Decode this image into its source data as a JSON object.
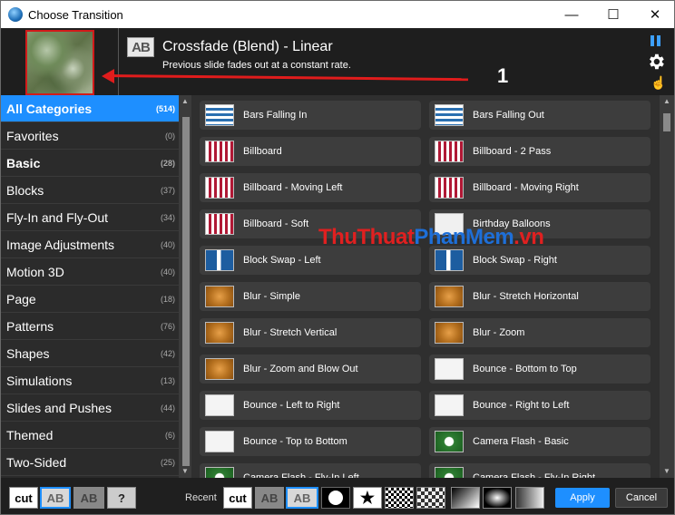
{
  "window": {
    "title": "Choose Transition",
    "minimize_glyph": "—",
    "maximize_glyph": "☐",
    "close_glyph": "✕"
  },
  "header": {
    "icon_text": "AB",
    "transition_name": "Crossfade (Blend) - Linear",
    "transition_desc": "Previous slide fades out at a constant rate.",
    "annotation_number": "1"
  },
  "categories": [
    {
      "label": "All Categories",
      "count": "(514)"
    },
    {
      "label": "Favorites",
      "count": "(0)"
    },
    {
      "label": "Basic",
      "count": "(28)"
    },
    {
      "label": "Blocks",
      "count": "(37)"
    },
    {
      "label": "Fly-In and Fly-Out",
      "count": "(34)"
    },
    {
      "label": "Image Adjustments",
      "count": "(40)"
    },
    {
      "label": "Motion 3D",
      "count": "(40)"
    },
    {
      "label": "Page",
      "count": "(18)"
    },
    {
      "label": "Patterns",
      "count": "(76)"
    },
    {
      "label": "Shapes",
      "count": "(42)"
    },
    {
      "label": "Simulations",
      "count": "(13)"
    },
    {
      "label": "Slides and Pushes",
      "count": "(44)"
    },
    {
      "label": "Themed",
      "count": "(6)"
    },
    {
      "label": "Two-Sided",
      "count": "(25)"
    }
  ],
  "transitions": [
    {
      "label": "Bars Falling In",
      "icon": "bars-icon"
    },
    {
      "label": "Bars Falling Out",
      "icon": "bars-icon"
    },
    {
      "label": "Billboard",
      "icon": "billboard-icon"
    },
    {
      "label": "Billboard - 2 Pass",
      "icon": "billboard-icon"
    },
    {
      "label": "Billboard - Moving Left",
      "icon": "billboard-icon"
    },
    {
      "label": "Billboard - Moving Right",
      "icon": "billboard-icon"
    },
    {
      "label": "Billboard - Soft",
      "icon": "billboard-icon"
    },
    {
      "label": "Birthday Balloons",
      "icon": "balloon-icon"
    },
    {
      "label": "Block Swap - Left",
      "icon": "blockswap-icon"
    },
    {
      "label": "Block Swap - Right",
      "icon": "blockswap-icon"
    },
    {
      "label": "Blur - Simple",
      "icon": "blur-icon"
    },
    {
      "label": "Blur - Stretch Horizontal",
      "icon": "blur-icon"
    },
    {
      "label": "Blur - Stretch Vertical",
      "icon": "blur-icon"
    },
    {
      "label": "Blur - Zoom",
      "icon": "blur-icon"
    },
    {
      "label": "Blur - Zoom and Blow Out",
      "icon": "blur-icon"
    },
    {
      "label": "Bounce - Bottom to Top",
      "icon": "bounce-icon"
    },
    {
      "label": "Bounce - Left to Right",
      "icon": "bounce-icon"
    },
    {
      "label": "Bounce - Right to Left",
      "icon": "bounce-icon"
    },
    {
      "label": "Bounce - Top to Bottom",
      "icon": "bounce-icon"
    },
    {
      "label": "Camera Flash - Basic",
      "icon": "camera-icon"
    },
    {
      "label": "Camera Flash - Fly-In Left",
      "icon": "camera-icon"
    },
    {
      "label": "Camera Flash - Fly-In Right",
      "icon": "camera-icon"
    }
  ],
  "bottom": {
    "cut": "cut",
    "ab": "AB",
    "question": "?",
    "recent_label": "Recent",
    "star": "★",
    "apply": "Apply",
    "cancel": "Cancel"
  },
  "watermark": {
    "part1": "Thu",
    "part2": "Thuat",
    "part3": "PhanMem",
    "part4": ".vn"
  }
}
